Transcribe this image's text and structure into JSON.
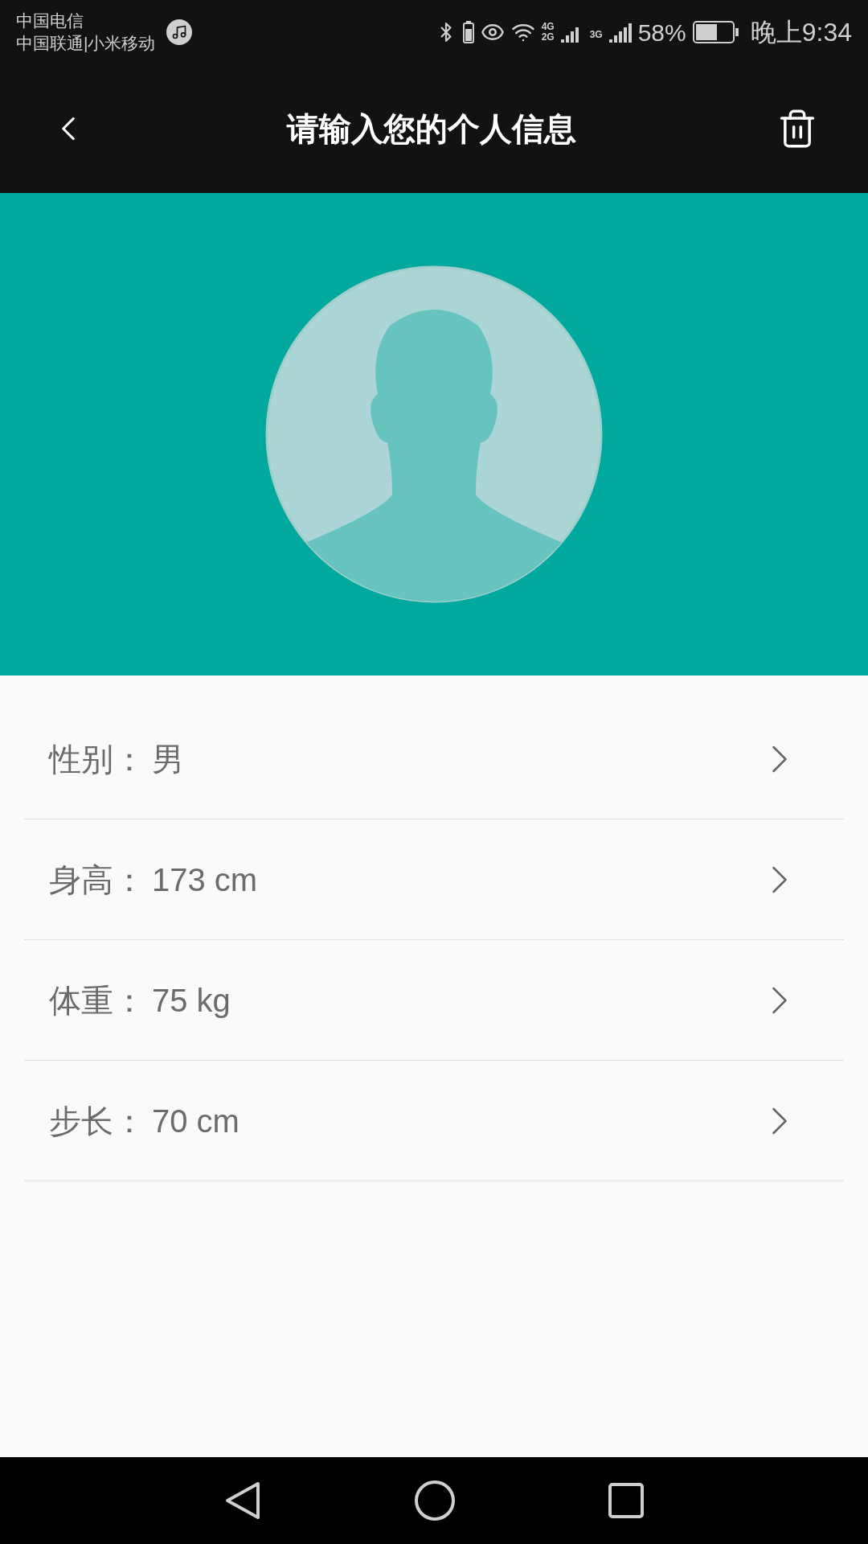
{
  "status_bar": {
    "carriers": [
      "中国电信",
      "中国联通|小米移动"
    ],
    "network_1": [
      "4G",
      "2G"
    ],
    "network_2": "3G",
    "battery_percent": "58%",
    "time": "晚上9:34"
  },
  "header": {
    "title": "请输入您的个人信息"
  },
  "fields": [
    {
      "label": "性别：",
      "value": "男"
    },
    {
      "label": "身高：",
      "value": "173 cm"
    },
    {
      "label": "体重：",
      "value": "75 kg"
    },
    {
      "label": "步长：",
      "value": "70 cm"
    }
  ]
}
